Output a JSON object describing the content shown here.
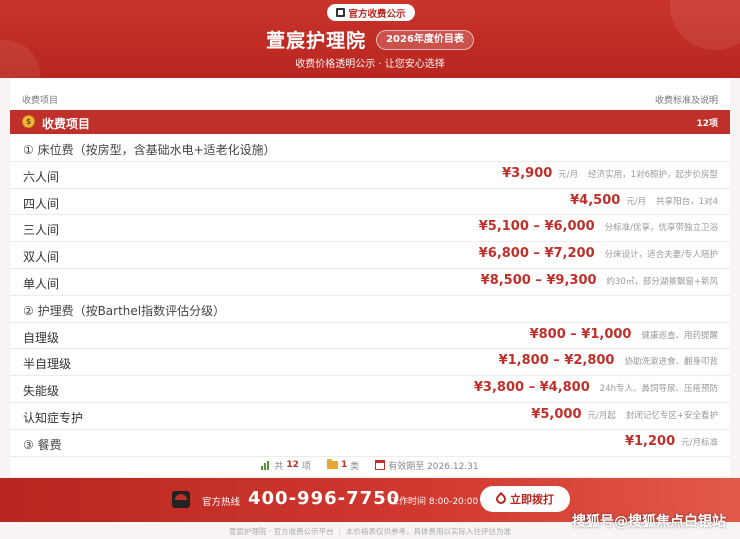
{
  "header": {
    "official_badge": "官方收费公示",
    "title": "萱宸护理院",
    "year_badge": "2026年度价目表",
    "subtitle": "收费价格透明公示 · 让您安心选择"
  },
  "table": {
    "col_left": "收费项目",
    "col_right": "收费标准及说明",
    "section_label": "收费项目",
    "section_count": "12项",
    "rows": [
      {
        "type": "cat",
        "name": "① 床位费（按房型，含基础水电+适老化设施）"
      },
      {
        "name": "六人间",
        "price": "¥3,900",
        "unit": "元/月",
        "note": "经济实用，1对6照护，起步价房型"
      },
      {
        "name": "四人间",
        "price": "¥4,500",
        "unit": "元/月",
        "note": "共享阳台，1对4"
      },
      {
        "name": "三人间",
        "price": "¥5,100 – ¥6,000",
        "unit": "",
        "note": "分标准/优享，优享带独立卫浴"
      },
      {
        "name": "双人间",
        "price": "¥6,800 – ¥7,200",
        "unit": "",
        "note": "分床设计，适合夫妻/专人陪护"
      },
      {
        "name": "单人间",
        "price": "¥8,500 – ¥9,300",
        "unit": "",
        "note": "约30㎡，部分湖景飘窗+新风"
      },
      {
        "type": "cat",
        "name": "② 护理费（按Barthel指数评估分级）"
      },
      {
        "name": "自理级",
        "price": "¥800 – ¥1,000",
        "unit": "",
        "note": "健康巡查、用药提醒"
      },
      {
        "name": "半自理级",
        "price": "¥1,800 – ¥2,800",
        "unit": "",
        "note": "协助洗漱进食、翻身叩背"
      },
      {
        "name": "失能级",
        "price": "¥3,800 – ¥4,800",
        "unit": "",
        "note": "24h专人、鼻饲导尿、压疮预防"
      },
      {
        "name": "认知症专护",
        "price": "¥5,000",
        "unit": "元/月起",
        "note": "封闭记忆专区+安全看护"
      },
      {
        "type": "cat",
        "name": "③ 餐费",
        "price": "¥1,200",
        "unit": "元/月标准",
        "note": ""
      }
    ]
  },
  "summary": {
    "total_prefix": "共",
    "total_num": "12",
    "total_suffix": "项",
    "cat_num": "1",
    "cat_suffix": "类",
    "valid": "有效期至 2026.12.31"
  },
  "footer": {
    "hotline_label": "官方热线",
    "hotline_number": "400-996-7750",
    "hours": "工作时间 8:00-20:00",
    "call_button": "立即拨打",
    "bottom_note": "萱宸护理院 · 官方收费公示平台 ｜ 本价格表仅供参考，具体费用以实际入住评估为准",
    "watermark": "搜狐号@搜狐焦点白银站"
  }
}
